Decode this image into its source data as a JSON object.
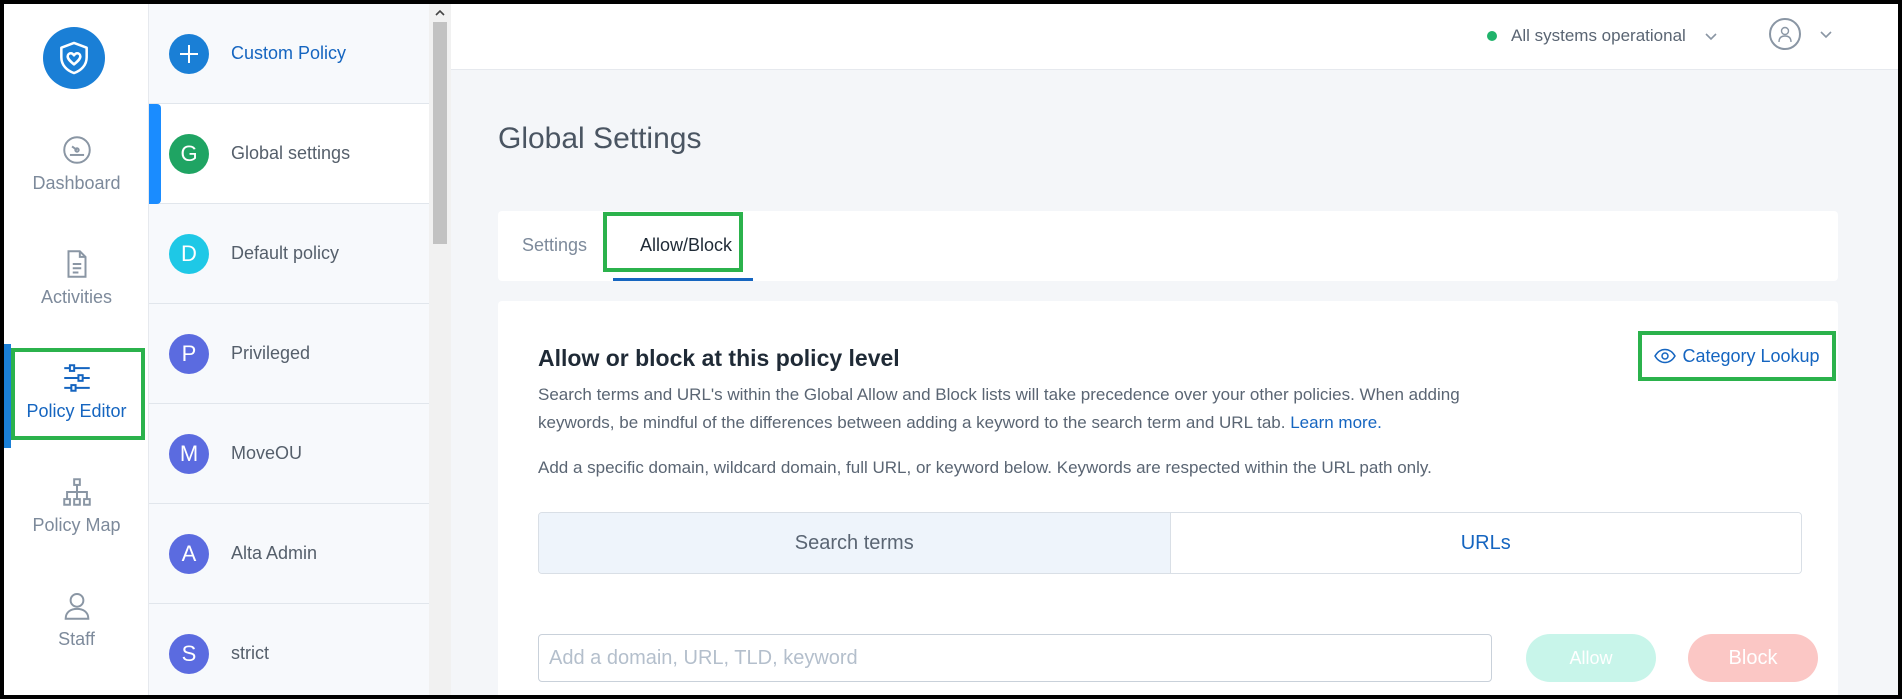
{
  "nav": {
    "items": [
      {
        "label": "Dashboard",
        "icon": "dashboard-icon"
      },
      {
        "label": "Activities",
        "icon": "document-icon"
      },
      {
        "label": "Policy Editor",
        "icon": "sliders-icon"
      },
      {
        "label": "Policy Map",
        "icon": "sitemap-icon"
      },
      {
        "label": "Staff",
        "icon": "person-icon"
      }
    ],
    "active": "Policy Editor"
  },
  "policy_list": {
    "items": [
      {
        "initial": "+",
        "name": "Custom Policy",
        "color": "#1a7fd6"
      },
      {
        "initial": "G",
        "name": "Global settings",
        "color": "#1fa463"
      },
      {
        "initial": "D",
        "name": "Default policy",
        "color": "#1ec8e6"
      },
      {
        "initial": "P",
        "name": "Privileged",
        "color": "#5b6be0"
      },
      {
        "initial": "M",
        "name": "MoveOU",
        "color": "#5b6be0"
      },
      {
        "initial": "A",
        "name": "Alta Admin",
        "color": "#5b6be0"
      },
      {
        "initial": "S",
        "name": "strict",
        "color": "#5b6be0"
      }
    ],
    "active_index": 1
  },
  "topbar": {
    "status_text": "All systems operational",
    "status_color": "#20b36b"
  },
  "page": {
    "title": "Global Settings",
    "tabs": [
      "Settings",
      "Allow/Block"
    ],
    "active_tab": "Allow/Block"
  },
  "card": {
    "title": "Allow or block at this policy level",
    "desc_text": "Search terms and URL's within the Global Allow and Block lists will take precedence over your other policies. When adding keywords, be mindful of the differences between adding a keyword to the search term and URL tab.",
    "learn_more": "Learn more.",
    "note": "Add a specific domain, wildcard domain, full URL, or keyword below. Keywords are respected within the URL path only.",
    "lookup_label": "Category Lookup",
    "segments": [
      "Search terms",
      "URLs"
    ],
    "active_segment": "Search terms",
    "input_placeholder": "Add a domain, URL, TLD, keyword",
    "allow_label": "Allow",
    "block_label": "Block"
  },
  "colors": {
    "accent": "#1565c0",
    "highlight": "#2bb24c"
  }
}
